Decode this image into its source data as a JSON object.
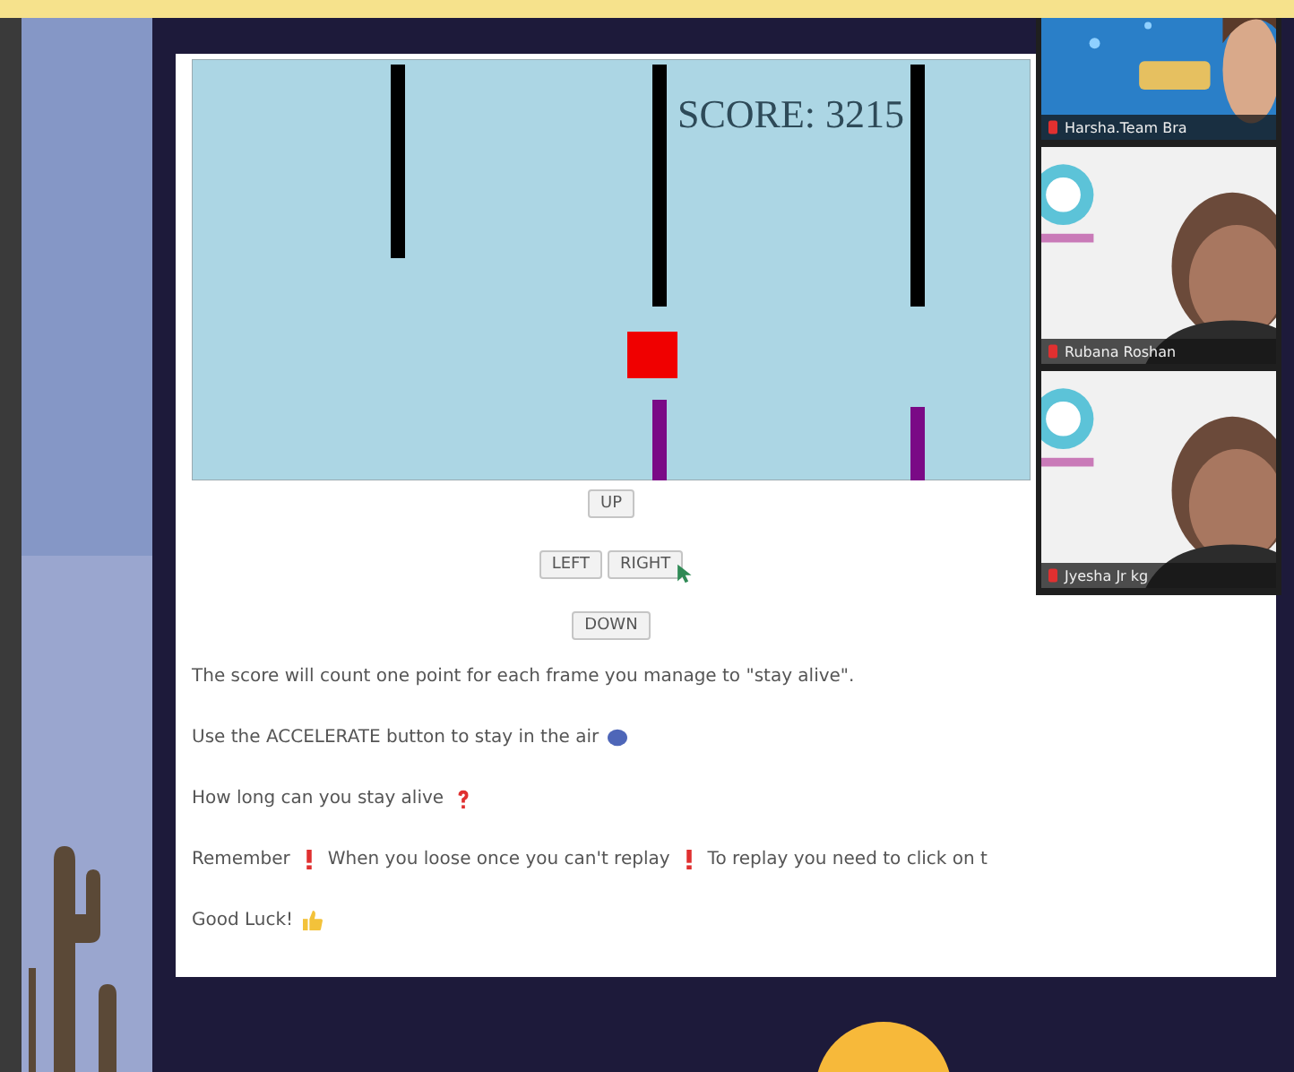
{
  "game": {
    "score": "SCORE: 3215"
  },
  "controls": [
    [
      "UP"
    ],
    [
      "LEFT",
      "RIGHT"
    ],
    [
      "DOWN"
    ]
  ],
  "instructions": [
    {
      "parts": [
        {
          "kind": "text",
          "text": "The score will count one point for each frame you manage to \"stay alive\"."
        }
      ]
    },
    {
      "parts": [
        {
          "kind": "text",
          "text": "Use the ACCELERATE button to stay in the air"
        },
        {
          "kind": "blue-dot"
        }
      ]
    },
    {
      "parts": [
        {
          "kind": "text",
          "text": "How long can you stay alive"
        },
        {
          "kind": "question"
        }
      ]
    },
    {
      "parts": [
        {
          "kind": "text",
          "text": "Remember"
        },
        {
          "kind": "exclaim"
        },
        {
          "kind": "text",
          "text": "When you loose once you can't replay"
        },
        {
          "kind": "exclaim"
        },
        {
          "kind": "text",
          "text": "To replay you need to click on t"
        }
      ]
    },
    {
      "parts": [
        {
          "kind": "text",
          "text": "Good Luck!"
        },
        {
          "kind": "thumbs"
        }
      ]
    }
  ],
  "participants": [
    {
      "name": "Harsha.Team Bra",
      "kind": "banner"
    },
    {
      "name": "Rubana Roshan",
      "kind": "logo"
    },
    {
      "name": "Jyesha Jr kg",
      "kind": "logo"
    }
  ]
}
